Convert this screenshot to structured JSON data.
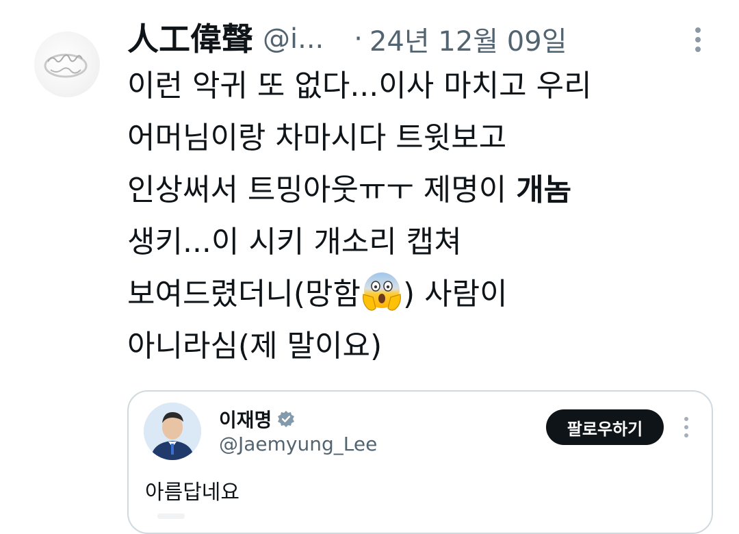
{
  "post": {
    "author_name": "人工偉聲",
    "handle": "@i...",
    "separator": "·",
    "date": "24년 12월 09일",
    "avatar_icon": "ring-avatar",
    "lines": [
      "이런 악귀 또 없다...이사 마치고 우리",
      "어머님이랑 차마시다 트윗보고",
      "인상써서 트밍아웃ㅠㅜ 제명이 ",
      "생키...이 시키 개소리 캡쳐",
      "보여드렸더니(망함",
      "아니라심(제 말이요)"
    ],
    "bold_word": "개놈",
    "line5_after": ") 사람이",
    "emoji_icon": "face-screaming-in-fear"
  },
  "quote": {
    "name": "이재명",
    "verified_icon": "verified-badge-icon",
    "handle": "@Jaemyung_Lee",
    "follow_label": "팔로우하기",
    "text": "아름답네요"
  },
  "colors": {
    "text": "#0f1419",
    "secondary": "#536471",
    "border": "#cfd9de",
    "button_bg": "#0f1419",
    "button_text": "#ffffff"
  }
}
